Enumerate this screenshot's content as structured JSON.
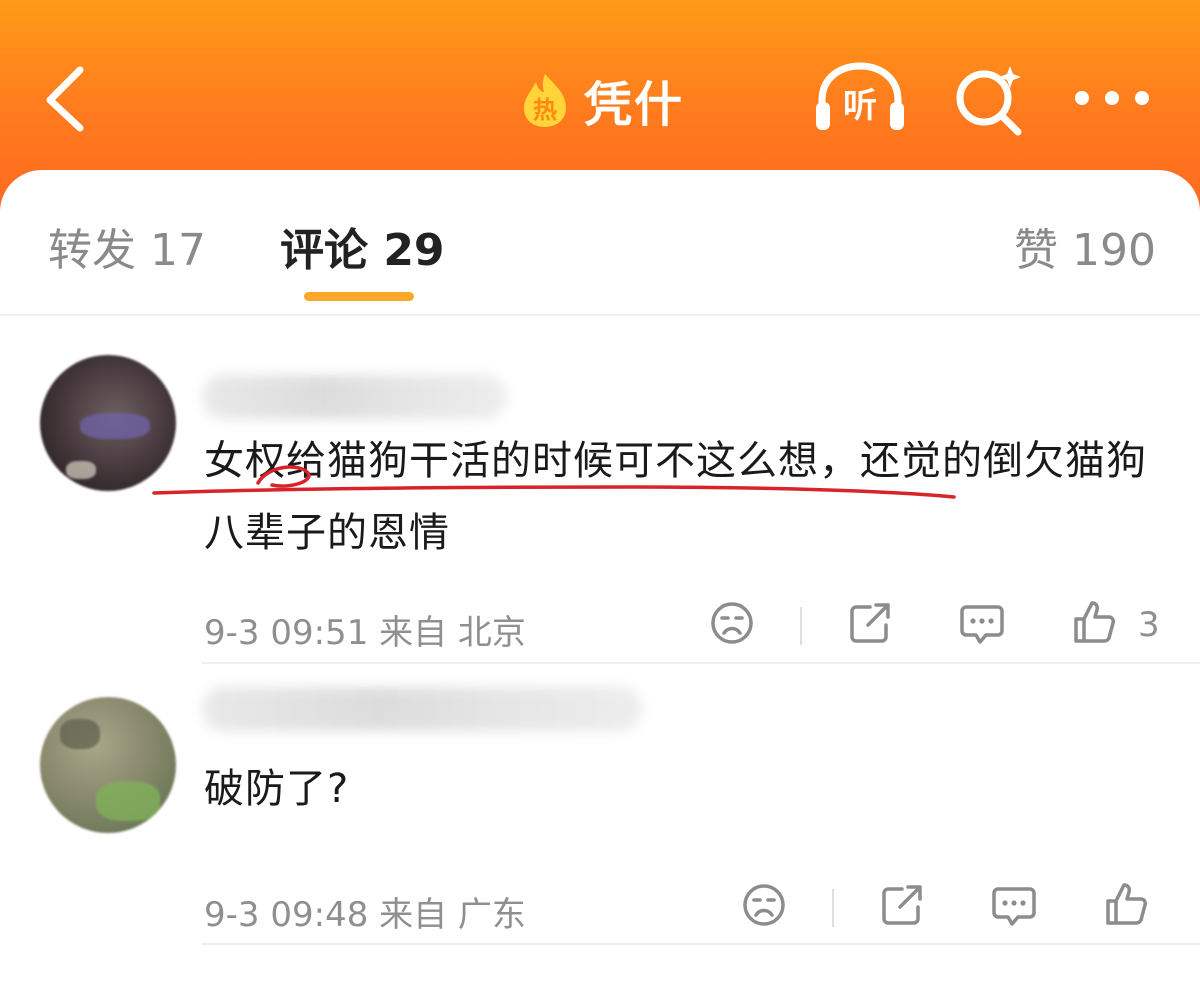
{
  "header": {
    "topic_badge": "热",
    "topic_title": "凭什",
    "listen_label": "听",
    "icons": [
      "back-chevron-icon",
      "listen-headphones-icon",
      "search-sparkle-icon",
      "more-dots-icon"
    ]
  },
  "tabs": {
    "reposts": "转发 17",
    "comments": "评论 29",
    "likes": "赞 190"
  },
  "colors": {
    "header_top": "#ff9a18",
    "header_bottom": "#ff6a22",
    "tab_indicator": "#f9a82a",
    "annotation_red": "#d8232a"
  },
  "comments": [
    {
      "text": "女权给猫狗干活的时候可不这么想，还觉的倒欠猫狗八辈子的恩情",
      "time_location": "9-3 09:51 来自 北京",
      "likes": "3"
    },
    {
      "text": "破防了?",
      "time_location": "9-3 09:48 来自 广东",
      "likes": ""
    }
  ]
}
